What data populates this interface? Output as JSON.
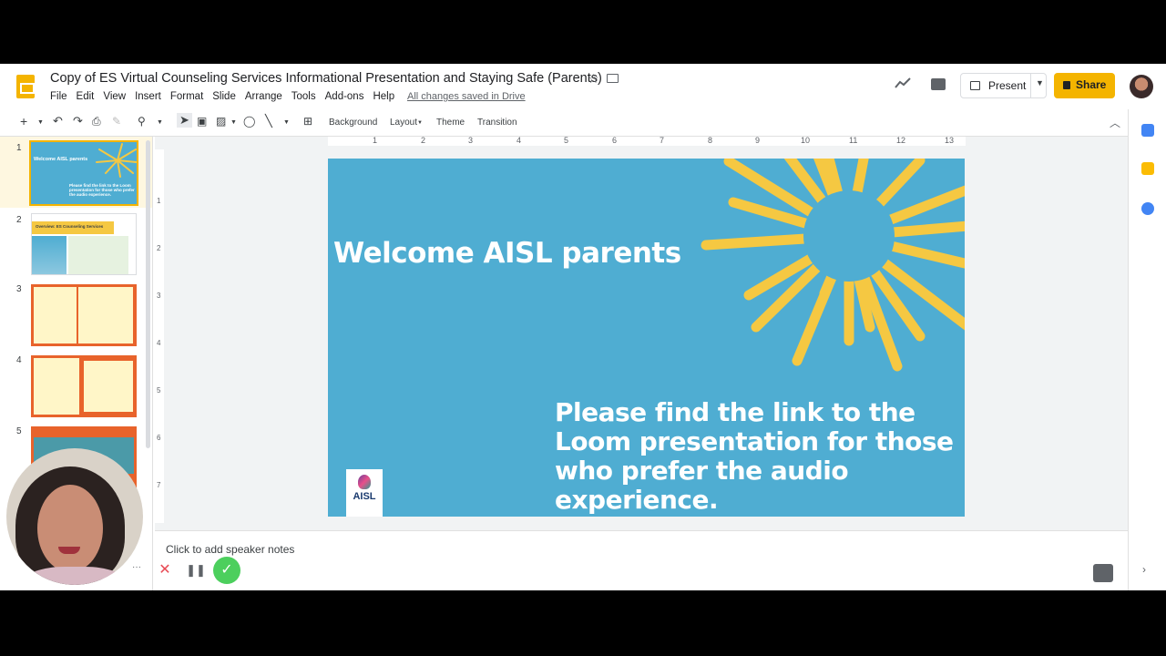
{
  "header": {
    "title": "Copy of ES Virtual Counseling Services Informational Presentation and Staying Safe (Parents)",
    "menu": [
      "File",
      "Edit",
      "View",
      "Insert",
      "Format",
      "Slide",
      "Arrange",
      "Tools",
      "Add-ons",
      "Help"
    ],
    "saved_status": "All changes saved in Drive",
    "present_label": "Present",
    "share_label": "Share"
  },
  "toolbar": {
    "background_label": "Background",
    "layout_label": "Layout",
    "theme_label": "Theme",
    "transition_label": "Transition"
  },
  "filmstrip": {
    "slides": [
      "1",
      "2",
      "3",
      "4",
      "5"
    ],
    "thumb1_title": "Welcome AISL parents",
    "thumb1_body": "Please find the link to the Loom presentation for those who prefer the audio experience.",
    "thumb2_title": "Overview: ES Counseling Services"
  },
  "ruler": {
    "top": [
      "1",
      "2",
      "3",
      "4",
      "5",
      "6",
      "7",
      "8",
      "9",
      "10",
      "11",
      "12",
      "13"
    ],
    "left": [
      "1",
      "2",
      "3",
      "4",
      "5",
      "6",
      "7"
    ]
  },
  "slide": {
    "title": "Welcome AISL parents",
    "body": "Please find the link to the Loom presentation for those who prefer the audio experience.",
    "logo_text": "AISL",
    "bg_color": "#4fadd2",
    "sun_color": "#f5c842"
  },
  "notes": {
    "placeholder": "Click to add speaker notes"
  },
  "loom": {
    "dots": "···",
    "cancel": "✕",
    "pause": "❚❚",
    "done": "✓"
  }
}
